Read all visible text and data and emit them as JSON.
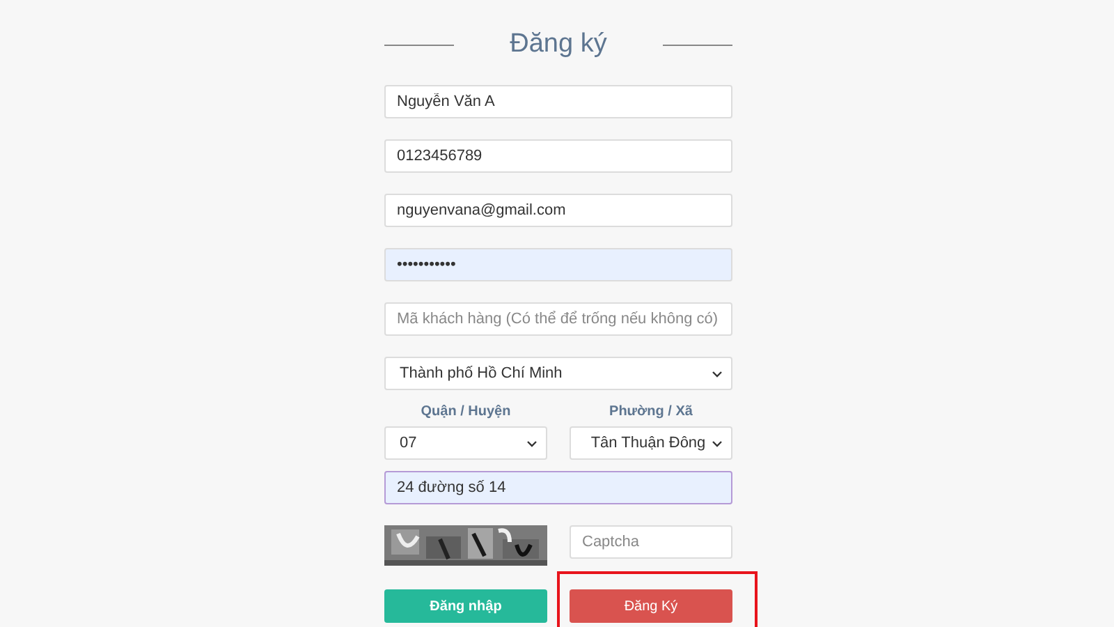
{
  "title": "Đăng ký",
  "fields": [
    {
      "kind": "input",
      "value": "Nguyễn Văn A",
      "focused": false
    },
    {
      "kind": "input",
      "value": "0123456789",
      "focused": false
    },
    {
      "kind": "input",
      "value": "nguyenvana@gmail.com",
      "focused": false
    },
    {
      "kind": "input",
      "value": "•••••••••••",
      "autofilled": true,
      "focused": false
    },
    {
      "kind": "input",
      "placeholder": "Mã khách hàng (Có thể để trống nếu không có)",
      "focused": false
    },
    {
      "kind": "select",
      "value": "Thành phố Hồ Chí Minh"
    }
  ],
  "district": {
    "label": "Quận / Huyện",
    "value": "07"
  },
  "ward": {
    "label": "Phường / Xã",
    "value": "Tân Thuận Đông"
  },
  "address": {
    "value": "24 đường số 14",
    "focused": true
  },
  "captcha": {
    "kind": "picture",
    "placeholder": "Captcha"
  },
  "buttons": [
    {
      "label": "Đăng nhập",
      "kind": "login"
    },
    {
      "label": "Đăng Ký",
      "kind": "register",
      "highlighted": true
    }
  ]
}
